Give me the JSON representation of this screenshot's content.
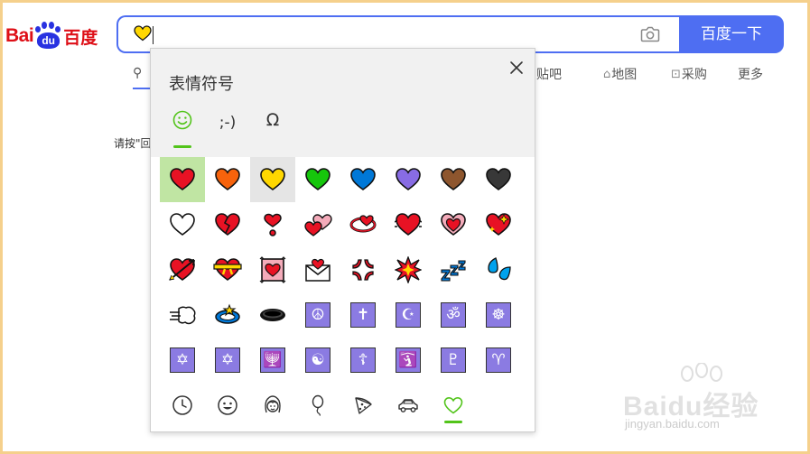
{
  "logo": {
    "bai": "Bai",
    "du": "du",
    "cn": "百度"
  },
  "search": {
    "value": "💛",
    "button_label": "百度一下"
  },
  "nav": {
    "items": [
      {
        "label": "贴吧",
        "icon": "tieba-icon"
      },
      {
        "label": "地图",
        "icon": "map-icon"
      },
      {
        "label": "采购",
        "icon": "basket-icon"
      },
      {
        "label": "更多",
        "icon": ""
      }
    ]
  },
  "hint_text": "请按\"回",
  "emoji_panel": {
    "title": "表情符号",
    "tabs": [
      {
        "label": "☺",
        "active": true
      },
      {
        "label": ";-)",
        "active": false
      },
      {
        "label": "Ω",
        "active": false
      }
    ],
    "rows": [
      [
        "red-heart",
        "orange-heart",
        "yellow-heart",
        "green-heart",
        "blue-heart",
        "purple-heart",
        "brown-heart",
        "black-heart"
      ],
      [
        "white-heart",
        "broken-heart",
        "heart-exclamation",
        "two-hearts",
        "revolving-hearts",
        "beating-heart",
        "growing-heart",
        "sparkling-heart"
      ],
      [
        "heart-with-arrow",
        "heart-with-ribbon",
        "heart-decoration",
        "love-letter",
        "anger-symbol",
        "collision",
        "zzz",
        "sweat-droplets"
      ],
      [
        "dashing-away",
        "dizzy",
        "hole",
        "peace-symbol",
        "latin-cross",
        "star-and-crescent",
        "om",
        "wheel-of-dharma"
      ],
      [
        "star-of-david",
        "six-pointed-star",
        "menorah",
        "yin-yang",
        "orthodox-cross",
        "place-of-worship",
        "pluto",
        "aries"
      ],
      [
        "clock",
        "smiley",
        "woman-face",
        "balloon",
        "pizza",
        "car",
        "green-heart-outline"
      ]
    ],
    "stamp_glyphs": {
      "peace-symbol": "☮",
      "latin-cross": "✝",
      "star-and-crescent": "☪",
      "om": "ॐ",
      "wheel-of-dharma": "☸",
      "star-of-david": "✡",
      "six-pointed-star": "✡",
      "menorah": "🕎",
      "yin-yang": "☯",
      "orthodox-cross": "☦",
      "place-of-worship": "🛐",
      "pluto": "♇",
      "aries": "♈"
    },
    "selected": "red-heart",
    "hovered": "yellow-heart"
  },
  "watermark": {
    "text": "Baidu经验",
    "url": "jingyan.baidu.com"
  },
  "colors": {
    "brand_blue": "#4e6ef2",
    "brand_red": "#de0f17",
    "selected_green": "#c0e5a3",
    "accent_green": "#52c41a",
    "stamp_purple": "#8b7be2"
  }
}
